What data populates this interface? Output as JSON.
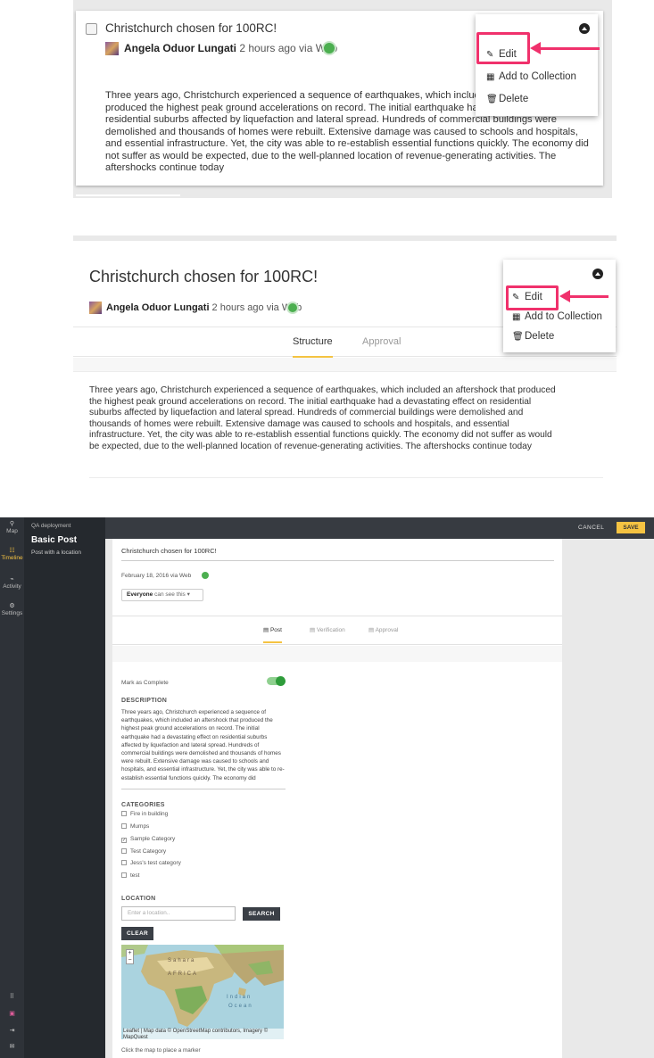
{
  "panel1": {
    "post_title": "Christchurch chosen for 100RC!",
    "author": "Angela Oduor Lungati",
    "meta": " 2 hours ago via Web",
    "body": "Three years ago, Christchurch experienced a sequence of earthquakes, which included an aftershock that produced the highest peak ground accelerations on record. The initial earthquake had a devastating effect on residential suburbs affected by liquefaction and lateral spread. Hundreds of commercial buildings were demolished and thousands of homes were rebuilt. Extensive damage was caused to schools and hospitals, and essential infrastructure. Yet, the city was able to re-establish essential functions quickly. The economy did not suffer as would be expected, due to the well-planned location of revenue-generating activities. The aftershocks continue today",
    "menu": [
      "Edit",
      "Add to Collection",
      "Delete"
    ]
  },
  "panel2": {
    "post_title": "Christchurch chosen for 100RC!",
    "author": "Angela Oduor Lungati",
    "meta": " 2 hours ago via Web",
    "tabs": [
      "Structure",
      "Approval"
    ],
    "body": "Three years ago, Christchurch experienced a sequence of earthquakes, which included an aftershock that produced the highest peak ground accelerations on record. The initial earthquake had a devastating effect on residential suburbs affected by liquefaction and lateral spread. Hundreds of commercial buildings were demolished and thousands of homes were rebuilt. Extensive damage was caused to schools and hospitals, and essential infrastructure. Yet, the city was able to re-establish essential functions quickly. The economy did not suffer as would be expected, due to the well-planned location of revenue-generating activities. The aftershocks continue today",
    "menu": [
      "Edit",
      "Add to Collection",
      "Delete"
    ]
  },
  "panel3": {
    "rail": [
      "Map",
      "Timeline",
      "Activity",
      "Settings"
    ],
    "deployment": "QA deployment",
    "survey_title": "Basic Post",
    "survey_subtitle": "Post with a location",
    "cancel": "CANCEL",
    "save": "SAVE",
    "post_title": "Christchurch chosen for 100RC!",
    "date": "February 18, 2016 via Web",
    "visibility_who": "Everyone",
    "visibility_rest": " can see this",
    "tabs": [
      "Post",
      "Verification",
      "Approval"
    ],
    "mark_complete": "Mark as Complete",
    "description_label": "DESCRIPTION",
    "description": "Three years ago, Christchurch experienced a sequence of earthquakes, which included an aftershock that produced the highest peak ground accelerations on record. The initial earthquake had a devastating effect on residential suburbs affected by liquefaction and lateral spread. Hundreds of commercial buildings were demolished and thousands of homes were rebuilt. Extensive damage was caused to schools and hospitals, and essential infrastructure. Yet, the city was able to re-establish essential functions quickly. The economy did",
    "categories_label": "CATEGORIES",
    "categories": [
      {
        "label": "Fire in building",
        "checked": false
      },
      {
        "label": "Mumps",
        "checked": false
      },
      {
        "label": "Sample Category",
        "checked": true
      },
      {
        "label": "Test Category",
        "checked": false
      },
      {
        "label": "Jess's test category",
        "checked": false
      },
      {
        "label": "test",
        "checked": false
      }
    ],
    "location_label": "LOCATION",
    "location_placeholder": "Enter a location..",
    "search": "SEARCH",
    "clear": "CLEAR",
    "map_labels": [
      "Sahara",
      "AFRICA",
      "Indian",
      "Ocean"
    ],
    "map_attribution": "Leaflet | Map data © OpenStreetMap contributors, Imagery © MapQuest",
    "map_hint": "Click the map to place a marker"
  },
  "colors": {
    "accent": "#f5c342",
    "highlight": "#f0316c",
    "success": "#4caf50",
    "rail": "#2e3238"
  }
}
